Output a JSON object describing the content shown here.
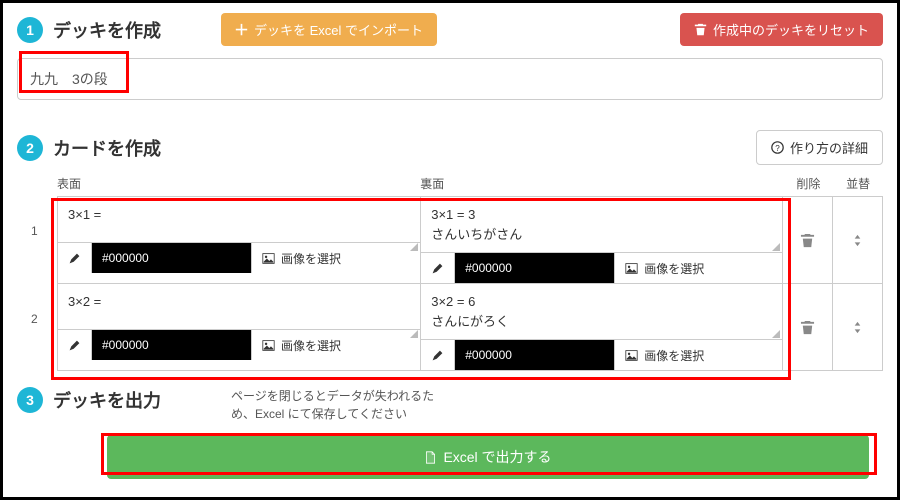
{
  "step1": {
    "num": "1",
    "title": "デッキを作成",
    "import_btn": "デッキを Excel でインポート",
    "reset_btn": "作成中のデッキをリセット",
    "deck_name": "九九　3の段"
  },
  "step2": {
    "num": "2",
    "title": "カードを作成",
    "detail_btn": "作り方の詳細",
    "headers": {
      "front": "表面",
      "back": "裏面",
      "del": "削除",
      "sort": "並替"
    },
    "rows": [
      {
        "n": "1",
        "front_text": "3×1 =",
        "back_text_line1": "3×1 = 3",
        "back_text_line2": "さんいちがさん",
        "front_color": "#000000",
        "back_color": "#000000",
        "image_label": "画像を選択"
      },
      {
        "n": "2",
        "front_text": "3×2 =",
        "back_text_line1": "3×2 = 6",
        "back_text_line2": "さんにがろく",
        "front_color": "#000000",
        "back_color": "#000000",
        "image_label": "画像を選択"
      }
    ]
  },
  "step3": {
    "num": "3",
    "title": "デッキを出力",
    "note_line1": "ページを閉じるとデータが失われるた",
    "note_line2": "め、Excel にて保存してください",
    "export_btn": "Excel で出力する"
  }
}
